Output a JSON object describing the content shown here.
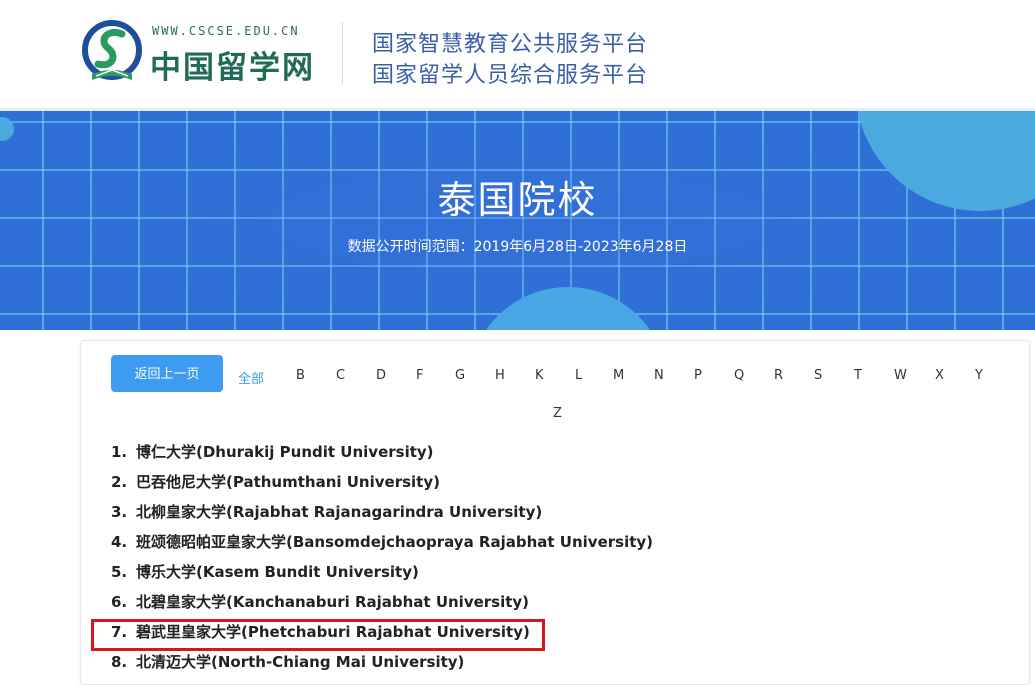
{
  "header": {
    "logo_url": "WWW.CSCSE.EDU.CN",
    "logo_name": "中国留学网",
    "platform_line1": "国家智慧教育公共服务平台",
    "platform_line2": "国家留学人员综合服务平台"
  },
  "banner": {
    "title": "泰国院校",
    "subtitle": "数据公开时间范围：2019年6月28日-2023年6月28日"
  },
  "nav": {
    "back_label": "返回上一页",
    "all_label": "全部",
    "letters": [
      "B",
      "C",
      "D",
      "F",
      "G",
      "H",
      "K",
      "L",
      "M",
      "N",
      "P",
      "Q",
      "R",
      "S",
      "T",
      "W",
      "X",
      "Y",
      "Z"
    ]
  },
  "universities": [
    {
      "num": "1.",
      "name": "博仁大学(Dhurakij Pundit University)"
    },
    {
      "num": "2.",
      "name": "巴吞他尼大学(Pathumthani University)"
    },
    {
      "num": "3.",
      "name": "北柳皇家大学(Rajabhat Rajanagarindra University)"
    },
    {
      "num": "4.",
      "name": "班颂德昭帕亚皇家大学(Bansomdejchaopraya Rajabhat University)"
    },
    {
      "num": "5.",
      "name": "博乐大学(Kasem Bundit University)"
    },
    {
      "num": "6.",
      "name": "北碧皇家大学(Kanchanaburi Rajabhat University)"
    },
    {
      "num": "7.",
      "name": "碧武里皇家大学(Phetchaburi Rajabhat University)"
    },
    {
      "num": "8.",
      "name": "北清迈大学(North-Chiang Mai University)"
    }
  ],
  "colors": {
    "accent": "#3d9bf2",
    "banner_blue": "#2f6fd6",
    "highlight_red": "#d8161d",
    "brand_green": "#1f6b56"
  },
  "icons": {
    "logo": "cscse-logo-icon"
  }
}
